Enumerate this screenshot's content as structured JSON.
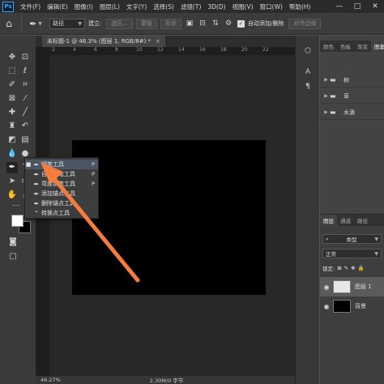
{
  "app": {
    "logo": "Ps"
  },
  "menubar": {
    "items": [
      "文件(F)",
      "编辑(E)",
      "图像(I)",
      "图层(L)",
      "文字(Y)",
      "选择(S)",
      "滤镜(T)",
      "3D(D)",
      "视图(V)",
      "窗口(W)",
      "帮助(H)"
    ],
    "window_controls": [
      "—",
      "□",
      "✕"
    ]
  },
  "optionsbar": {
    "mode_value": "路径",
    "make_label": "建立:",
    "selection_btn": "选区...",
    "mask_btn": "蒙版",
    "shape_btn": "形状",
    "auto_add_delete": "自动添加/删除",
    "align_edges": "对齐边缘",
    "checkmark": "✓"
  },
  "document": {
    "tab_title": "未标题-1 @ 46.3% (图层 1, RGB/8#) *",
    "close": "×",
    "ruler_numbers": [
      "2",
      "4",
      "6",
      "8",
      "10",
      "12",
      "14",
      "16",
      "18",
      "20",
      "22"
    ]
  },
  "statusbar": {
    "zoom": "46.27%",
    "doc_info": "2.30M/0 字节"
  },
  "flyout": {
    "items": [
      {
        "label": "钢笔工具",
        "shortcut": "P",
        "selected": true
      },
      {
        "label": "自由钢笔工具",
        "shortcut": "P",
        "selected": false
      },
      {
        "label": "弯度钢笔工具",
        "shortcut": "P",
        "selected": false
      },
      {
        "label": "添加锚点工具",
        "shortcut": "",
        "selected": false
      },
      {
        "label": "删除锚点工具",
        "shortcut": "",
        "selected": false
      },
      {
        "label": "转换点工具",
        "shortcut": "",
        "selected": false
      }
    ]
  },
  "swatches_panel": {
    "tabs": [
      "颜色",
      "色板",
      "渐变",
      "图案"
    ],
    "groups": [
      "树",
      "草",
      "水滴"
    ]
  },
  "layers_panel": {
    "tabs": [
      "图层",
      "通道",
      "路径"
    ],
    "filter_value": "类型",
    "blend_mode": "正常",
    "lock_label": "锁定:",
    "layers": [
      {
        "name": "图层 1",
        "selected": true,
        "thumb_color": "#e6e6e6"
      },
      {
        "name": "背景",
        "selected": false,
        "thumb_color": "#000000"
      }
    ]
  },
  "colors": {
    "foreground": "#ffffff",
    "background": "#000000",
    "arrow": "#f47c3c"
  }
}
